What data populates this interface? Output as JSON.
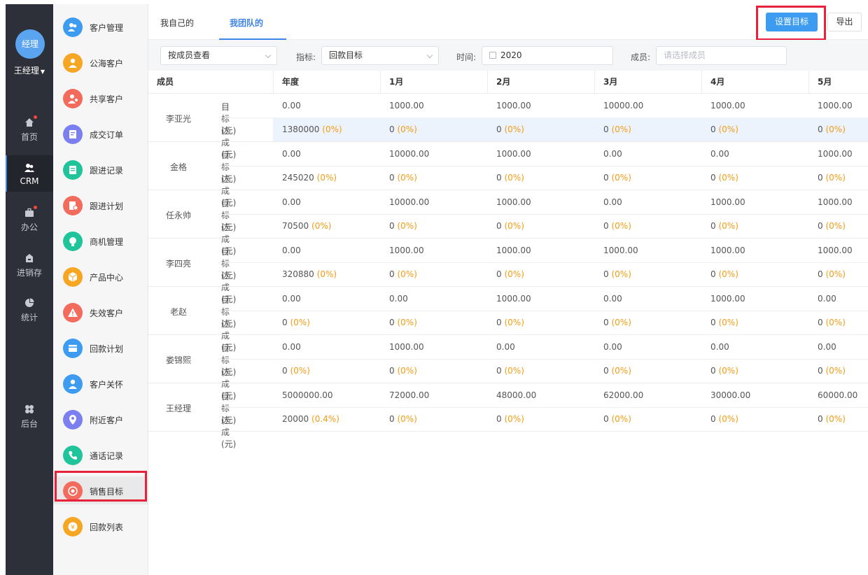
{
  "user": {
    "avatar_text": "经理",
    "name": "王经理"
  },
  "rail": [
    {
      "label": "首页",
      "icon": "home-icon",
      "dot": true
    },
    {
      "label": "CRM",
      "icon": "crm-people-icon",
      "active": true
    },
    {
      "label": "办公",
      "icon": "briefcase-icon",
      "dot": true
    },
    {
      "label": "进销存",
      "icon": "inventory-icon"
    },
    {
      "label": "统计",
      "icon": "pie-chart-icon"
    },
    {
      "label": "后台",
      "icon": "settings-grid-icon"
    }
  ],
  "sidebar": [
    {
      "label": "客户管理",
      "icon": "customers-icon",
      "color": "#3e9cf0"
    },
    {
      "label": "公海客户",
      "icon": "public-customer-icon",
      "color": "#f5a623"
    },
    {
      "label": "共享客户",
      "icon": "shared-customer-icon",
      "color": "#f36b5d"
    },
    {
      "label": "成交订单",
      "icon": "order-icon",
      "color": "#7b7ff0"
    },
    {
      "label": "跟进记录",
      "icon": "follow-record-icon",
      "color": "#1fc49a"
    },
    {
      "label": "跟进计划",
      "icon": "follow-plan-icon",
      "color": "#f36b5d"
    },
    {
      "label": "商机管理",
      "icon": "opportunity-icon",
      "color": "#1fc49a"
    },
    {
      "label": "产品中心",
      "icon": "product-icon",
      "color": "#f5a623"
    },
    {
      "label": "失效客户",
      "icon": "warning-icon",
      "color": "#f36b5d"
    },
    {
      "label": "回款计划",
      "icon": "payment-plan-icon",
      "color": "#3e9cf0"
    },
    {
      "label": "客户关怀",
      "icon": "care-icon",
      "color": "#3e9cf0"
    },
    {
      "label": "附近客户",
      "icon": "location-icon",
      "color": "#7b7ff0"
    },
    {
      "label": "通话记录",
      "icon": "phone-icon",
      "color": "#1fc49a"
    },
    {
      "label": "销售目标",
      "icon": "target-icon",
      "color": "#f36b5d",
      "active": true
    },
    {
      "label": "回款列表",
      "icon": "payment-list-icon",
      "color": "#f5a623"
    }
  ],
  "tabs": {
    "mine": "我自己的",
    "team": "我团队的"
  },
  "toolbar": {
    "set_target": "设置目标",
    "export": "导出"
  },
  "filters": {
    "view_by": "按成员查看",
    "indicator_label": "指标:",
    "indicator_value": "回款目标",
    "time_label": "时间:",
    "time_value": "2020",
    "member_label": "成员:",
    "member_placeholder": "请选择成员"
  },
  "table": {
    "headers": [
      "成员",
      "年度",
      "1月",
      "2月",
      "3月",
      "4月",
      "5月"
    ],
    "target_label": "目标(元)",
    "done_label": "达成(元)",
    "rows": [
      {
        "name": "李亚光",
        "target": [
          "0.00",
          "1000.00",
          "1000.00",
          "10000.00",
          "1000.00",
          "1000.00"
        ],
        "done": [
          [
            "1380000",
            "(0%)"
          ],
          [
            "0",
            "(0%)"
          ],
          [
            "0",
            "(0%)"
          ],
          [
            "0",
            "(0%)"
          ],
          [
            "0",
            "(0%)"
          ],
          [
            "0",
            "(0%)"
          ]
        ]
      },
      {
        "name": "金格",
        "target": [
          "0.00",
          "10000.00",
          "1000.00",
          "0.00",
          "0.00",
          "1000.00"
        ],
        "done": [
          [
            "245020",
            "(0%)"
          ],
          [
            "0",
            "(0%)"
          ],
          [
            "0",
            "(0%)"
          ],
          [
            "0",
            "(0%)"
          ],
          [
            "0",
            "(0%)"
          ],
          [
            "0",
            "(0%)"
          ]
        ]
      },
      {
        "name": "任永帅",
        "target": [
          "0.00",
          "10000.00",
          "1000.00",
          "0.00",
          "1000.00",
          "1000.00"
        ],
        "done": [
          [
            "70500",
            "(0%)"
          ],
          [
            "0",
            "(0%)"
          ],
          [
            "0",
            "(0%)"
          ],
          [
            "0",
            "(0%)"
          ],
          [
            "0",
            "(0%)"
          ],
          [
            "0",
            "(0%)"
          ]
        ]
      },
      {
        "name": "李四亮",
        "target": [
          "0.00",
          "1000.00",
          "1000.00",
          "1000.00",
          "1000.00",
          "1000.00"
        ],
        "done": [
          [
            "320880",
            "(0%)"
          ],
          [
            "0",
            "(0%)"
          ],
          [
            "0",
            "(0%)"
          ],
          [
            "0",
            "(0%)"
          ],
          [
            "0",
            "(0%)"
          ],
          [
            "0",
            "(0%)"
          ]
        ]
      },
      {
        "name": "老赵",
        "target": [
          "0.00",
          "0.00",
          "1000.00",
          "0.00",
          "1000.00",
          "0.00"
        ],
        "done": [
          [
            "0",
            "(0%)"
          ],
          [
            "0",
            "(0%)"
          ],
          [
            "0",
            "(0%)"
          ],
          [
            "0",
            "(0%)"
          ],
          [
            "0",
            "(0%)"
          ],
          [
            "0",
            "(0%)"
          ]
        ]
      },
      {
        "name": "娄锦熙",
        "target": [
          "0.00",
          "1000.00",
          "0.00",
          "0.00",
          "0.00",
          "0.00"
        ],
        "done": [
          [
            "0",
            "(0%)"
          ],
          [
            "0",
            "(0%)"
          ],
          [
            "0",
            "(0%)"
          ],
          [
            "0",
            "(0%)"
          ],
          [
            "0",
            "(0%)"
          ],
          [
            "0",
            "(0%)"
          ]
        ]
      },
      {
        "name": "王经理",
        "target": [
          "5000000.00",
          "72000.00",
          "48000.00",
          "62000.00",
          "30000.00",
          "60000.00"
        ],
        "done": [
          [
            "20000",
            "(0.4%)"
          ],
          [
            "0",
            "(0%)"
          ],
          [
            "0",
            "(0%)"
          ],
          [
            "0",
            "(0%)"
          ],
          [
            "0",
            "(0%)"
          ],
          [
            "0",
            "(0%)"
          ]
        ]
      }
    ]
  }
}
